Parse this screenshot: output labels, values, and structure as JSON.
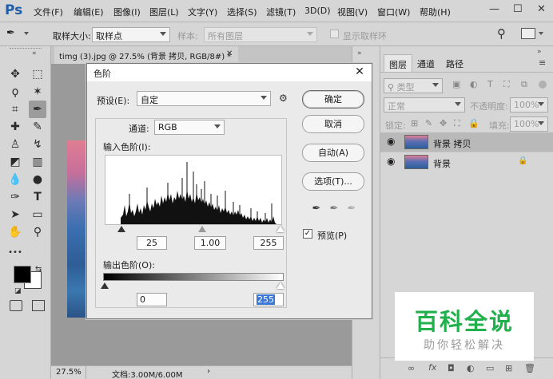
{
  "app": {
    "logo": "Ps"
  },
  "menu": [
    "文件(F)",
    "编辑(E)",
    "图像(I)",
    "图层(L)",
    "文字(Y)",
    "选择(S)",
    "滤镜(T)",
    "3D(D)",
    "视图(V)",
    "窗口(W)",
    "帮助(H)"
  ],
  "window_controls": {
    "minimize": "—",
    "maximize": "☐",
    "close": "✕"
  },
  "options": {
    "sample_size_label": "取样大小:",
    "sample_size_value": "取样点",
    "sample_label": "样本:",
    "sample_value": "所有图层",
    "show_ring_label": "显示取样环"
  },
  "document": {
    "tab_title": "timg (3).jpg @ 27.5% (背景 拷贝, RGB/8#) *",
    "tab_close": "✕",
    "zoom": "27.5%",
    "doc_size": "文档:3.00M/6.00M"
  },
  "tools": [
    {
      "name": "move-tool",
      "glyph": "✥"
    },
    {
      "name": "marquee-tool",
      "glyph": "⬚"
    },
    {
      "name": "lasso-tool",
      "glyph": "ϙ"
    },
    {
      "name": "magic-wand-tool",
      "glyph": "✶"
    },
    {
      "name": "crop-tool",
      "glyph": "⌗"
    },
    {
      "name": "eyedropper-tool",
      "glyph": "✒"
    },
    {
      "name": "healing-brush-tool",
      "glyph": "✚"
    },
    {
      "name": "brush-tool",
      "glyph": "✎"
    },
    {
      "name": "clone-stamp-tool",
      "glyph": "♙"
    },
    {
      "name": "history-brush-tool",
      "glyph": "↯"
    },
    {
      "name": "eraser-tool",
      "glyph": "◩"
    },
    {
      "name": "gradient-tool",
      "glyph": "▥"
    },
    {
      "name": "blur-tool",
      "glyph": "💧"
    },
    {
      "name": "dodge-tool",
      "glyph": "●"
    },
    {
      "name": "pen-tool",
      "glyph": "✑"
    },
    {
      "name": "type-tool",
      "glyph": "T"
    },
    {
      "name": "path-selection-tool",
      "glyph": "➤"
    },
    {
      "name": "rectangle-tool",
      "glyph": "▭"
    },
    {
      "name": "hand-tool",
      "glyph": "✋"
    },
    {
      "name": "zoom-tool",
      "glyph": "⚲"
    },
    {
      "name": "more-tools",
      "glyph": "•••"
    }
  ],
  "panels": {
    "tabs": [
      "图层",
      "通道",
      "路径"
    ],
    "filter_kind": "类型",
    "blend_mode": "正常",
    "opacity_label": "不透明度:",
    "opacity_value": "100%",
    "lock_label": "锁定:",
    "fill_label": "填充:",
    "fill_value": "100%",
    "layers": [
      {
        "name": "背景 拷贝",
        "selected": true
      },
      {
        "name": "背景",
        "selected": false
      }
    ]
  },
  "dialog": {
    "title": "色阶",
    "preset_label": "预设(E):",
    "preset_value": "自定",
    "channel_label": "通道:",
    "channel_value": "RGB",
    "input_levels_label": "输入色阶(I):",
    "input_black": "25",
    "input_gamma": "1.00",
    "input_white": "255",
    "output_levels_label": "输出色阶(O):",
    "output_black": "0",
    "output_white": "255",
    "buttons": {
      "ok": "确定",
      "cancel": "取消",
      "auto": "自动(A)",
      "options": "选项(T)..."
    },
    "preview_label": "预览(P)",
    "preview_checked": true
  },
  "watermark": {
    "title": "百科全说",
    "subtitle": "助你轻松解决"
  },
  "colors": {
    "accent": "#1f5ea8",
    "selection": "#3a77d6",
    "watermark_green": "#22b04c"
  }
}
